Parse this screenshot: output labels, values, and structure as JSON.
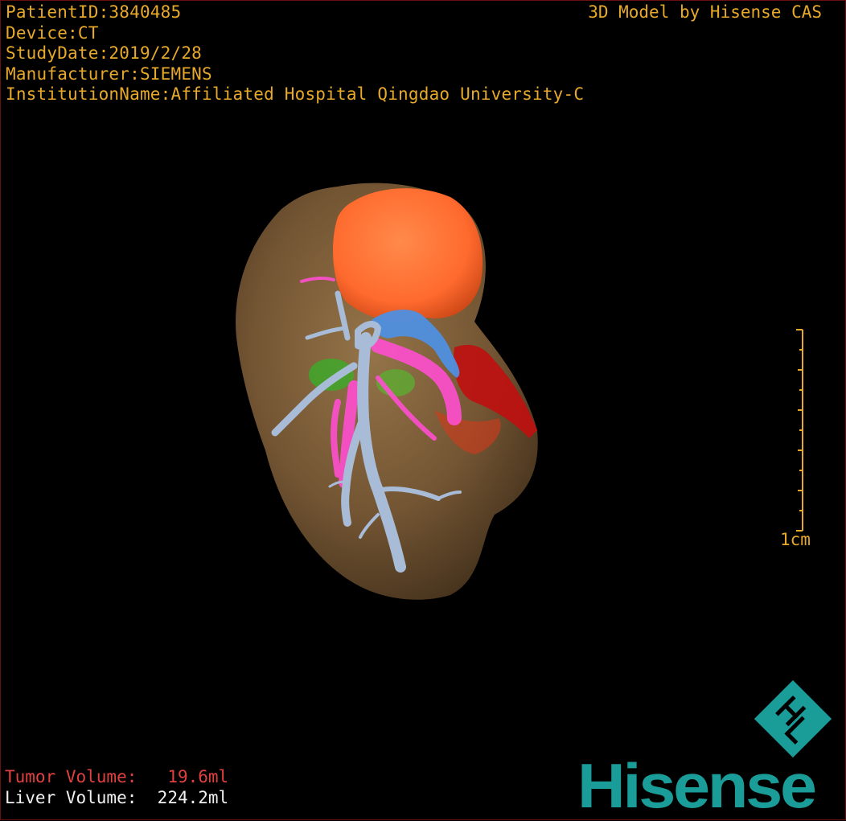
{
  "header": {
    "patient_id": "PatientID:3840485",
    "device": "Device:CT",
    "study_date": "StudyDate:2019/2/28",
    "manufacturer": "Manufacturer:SIEMENS",
    "institution": "InstitutionName:Affiliated Hospital Qingdao University-C",
    "model_credit": "3D Model by Hisense CAS"
  },
  "scale": {
    "label": "1cm"
  },
  "stats": {
    "tumor_label": "Tumor Volume:",
    "tumor_value": "19.6ml",
    "liver_label": "Liver Volume:",
    "liver_value": "224.2ml"
  },
  "brand": {
    "wordmark": "Hisense",
    "logo_letters": "HL"
  },
  "colors": {
    "text_accent": "#e8a92a",
    "tumor_text": "#e04040",
    "liver": "#7a5a36",
    "tumor": "#ff6a2e",
    "portal_vein": "#a8bcd8",
    "hepatic_vein": "#ff4fd0",
    "artery": "#c01010",
    "gallbladder": "#3ea82a",
    "vena_cava": "#4f8fe0",
    "brand_teal": "#1a9c98"
  }
}
